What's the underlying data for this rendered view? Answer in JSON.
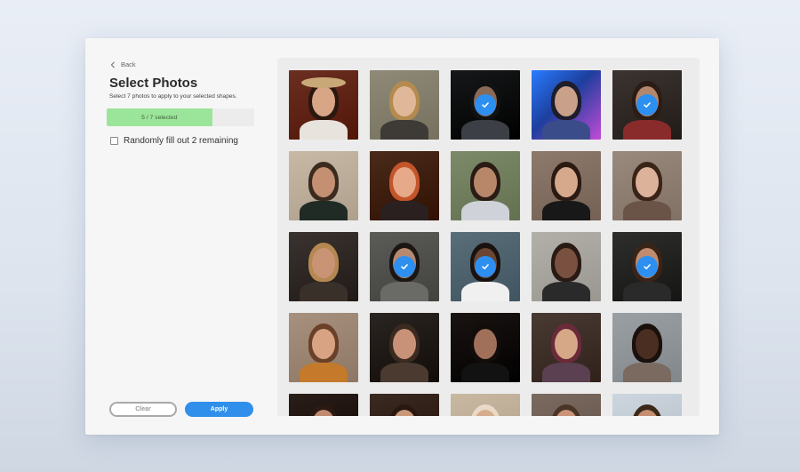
{
  "back": {
    "label": "Back"
  },
  "title": "Select Photos",
  "subtitle": "Select 7 photos to apply to your selected shapes.",
  "progress": {
    "label": "5 / 7 selected",
    "selected": 5,
    "total": 7
  },
  "random_fill": {
    "label": "Randomly fill out 2 remaining",
    "checked": false
  },
  "buttons": {
    "clear": "Clear",
    "apply": "Apply"
  },
  "colors": {
    "accent": "#2f8fea",
    "progress_fill": "#9be59a",
    "check": "#2d8ff0"
  },
  "photos": [
    {
      "bg": "#6b2f22",
      "skin": "#d9a587",
      "hair": "#2a1810",
      "body": "#e8e3dc",
      "selected": false,
      "hat": true
    },
    {
      "bg": "#8f8a77",
      "skin": "#e0b899",
      "hair": "#b58a4e",
      "body": "#3e3a35",
      "selected": false
    },
    {
      "bg": "#161819",
      "skin": "#8a6a56",
      "hair": "#111",
      "body": "#3c3f45",
      "selected": true
    },
    {
      "bg": "#1c4b9b",
      "skin": "#c9a08a",
      "hair": "#1d1d2b",
      "body": "#3a4c8a",
      "selected": false,
      "neon": true
    },
    {
      "bg": "#3b3430",
      "skin": "#b4876c",
      "hair": "#2b1c14",
      "body": "#8a2b2b",
      "selected": true
    },
    {
      "bg": "#c8b8a6",
      "skin": "#c48f72",
      "hair": "#3b2a1e",
      "body": "#1f2b24",
      "selected": false
    },
    {
      "bg": "#4a2a1a",
      "skin": "#e6a98a",
      "hair": "#c4552a",
      "body": "#2a2020",
      "selected": false
    },
    {
      "bg": "#7d8a6a",
      "skin": "#b8876a",
      "hair": "#2a1c14",
      "body": "#cfd3d9",
      "selected": false
    },
    {
      "bg": "#8d7a6c",
      "skin": "#d6a88c",
      "hair": "#2a1a12",
      "body": "#181818",
      "selected": false
    },
    {
      "bg": "#9a8a7e",
      "skin": "#dcb29a",
      "hair": "#3a2418",
      "body": "#6a5448",
      "selected": false
    },
    {
      "bg": "#3a3330",
      "skin": "#c99475",
      "hair": "#b48850",
      "body": "#3a302a",
      "selected": false
    },
    {
      "bg": "#5b5b58",
      "skin": "#b58a70",
      "hair": "#1c1612",
      "body": "#6a6a66",
      "selected": true
    },
    {
      "bg": "#5a6e7a",
      "skin": "#6b4634",
      "hair": "#1a120e",
      "body": "#f0f0f0",
      "selected": true
    },
    {
      "bg": "#b3b0aa",
      "skin": "#7a5140",
      "hair": "#2a1a14",
      "body": "#2a2a2a",
      "selected": false
    },
    {
      "bg": "#2e2e2c",
      "skin": "#c08c70",
      "hair": "#3a2418",
      "body": "#2a2a2a",
      "selected": true
    },
    {
      "bg": "#a7907e",
      "skin": "#d8a383",
      "hair": "#6a4028",
      "body": "#c47a2a",
      "selected": false
    },
    {
      "bg": "#2b2522",
      "skin": "#c89278",
      "hair": "#3a2a20",
      "body": "#4a3a30",
      "selected": false
    },
    {
      "bg": "#1a1412",
      "skin": "#a0705a",
      "hair": "#120c0a",
      "body": "#121212",
      "selected": false
    },
    {
      "bg": "#4a3a34",
      "skin": "#d6a888",
      "hair": "#6a2a3a",
      "body": "#5a4050",
      "selected": false
    },
    {
      "bg": "#9aa0a4",
      "skin": "#4a2e22",
      "hair": "#1a100c",
      "body": "#7a6a60",
      "selected": false
    },
    {
      "bg": "#2a1e1a",
      "skin": "#c08a70",
      "hair": "#2a1a12",
      "body": "#333",
      "selected": false
    },
    {
      "bg": "#3a2a22",
      "skin": "#c9987a",
      "hair": "#2a1810",
      "body": "#333",
      "selected": false
    },
    {
      "bg": "#c9b8a2",
      "skin": "#d7ad90",
      "hair": "#e8dac6",
      "body": "#999",
      "selected": false
    },
    {
      "bg": "#7a6a60",
      "skin": "#c99478",
      "hair": "#4a3426",
      "body": "#555",
      "selected": false
    },
    {
      "bg": "#cdd6de",
      "skin": "#c48e70",
      "hair": "#3a2818",
      "body": "#777",
      "selected": false
    }
  ]
}
